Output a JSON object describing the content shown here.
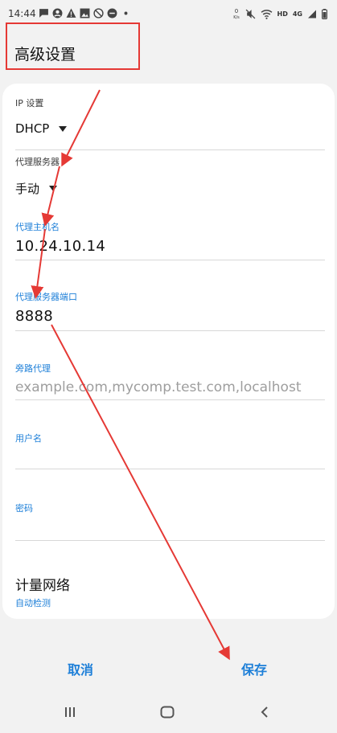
{
  "status_bar": {
    "time": "14:44",
    "network_speed": "0\nK/s",
    "hd": "HD",
    "net_type": "4G"
  },
  "title": "高级设置",
  "ip_settings": {
    "label": "IP 设置",
    "value": "DHCP"
  },
  "proxy": {
    "label": "代理服务器",
    "value": "手动"
  },
  "proxy_host": {
    "label": "代理主机名",
    "value": "10.24.10.14"
  },
  "proxy_port": {
    "label": "代理服务器端口",
    "value": "8888"
  },
  "bypass": {
    "label": "旁路代理",
    "placeholder": "example.com,mycomp.test.com,localhost"
  },
  "username": {
    "label": "用户名",
    "value": ""
  },
  "password": {
    "label": "密码",
    "value": ""
  },
  "metered": {
    "title": "计量网络",
    "value": "自动检测"
  },
  "buttons": {
    "cancel": "取消",
    "save": "保存"
  },
  "colors": {
    "accent": "#1d7fd8",
    "annotation": "#e53935"
  }
}
